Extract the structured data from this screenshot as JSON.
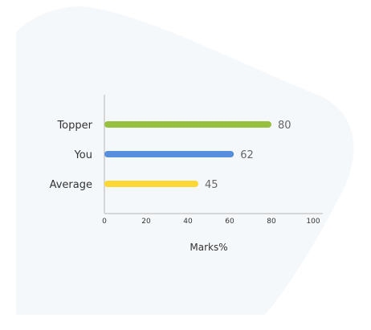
{
  "chart_data": {
    "type": "bar",
    "orientation": "horizontal",
    "categories": [
      "Topper",
      "You",
      "Average"
    ],
    "values": [
      80,
      62,
      45
    ],
    "colors": [
      "#97c03f",
      "#5690dc",
      "#fdd835"
    ],
    "xlabel": "Marks%",
    "ylabel": "",
    "xlim": [
      0,
      100
    ],
    "xticks": [
      "0",
      "20",
      "40",
      "60",
      "80",
      "100"
    ],
    "grid": false,
    "background": "#f5f8fb"
  }
}
